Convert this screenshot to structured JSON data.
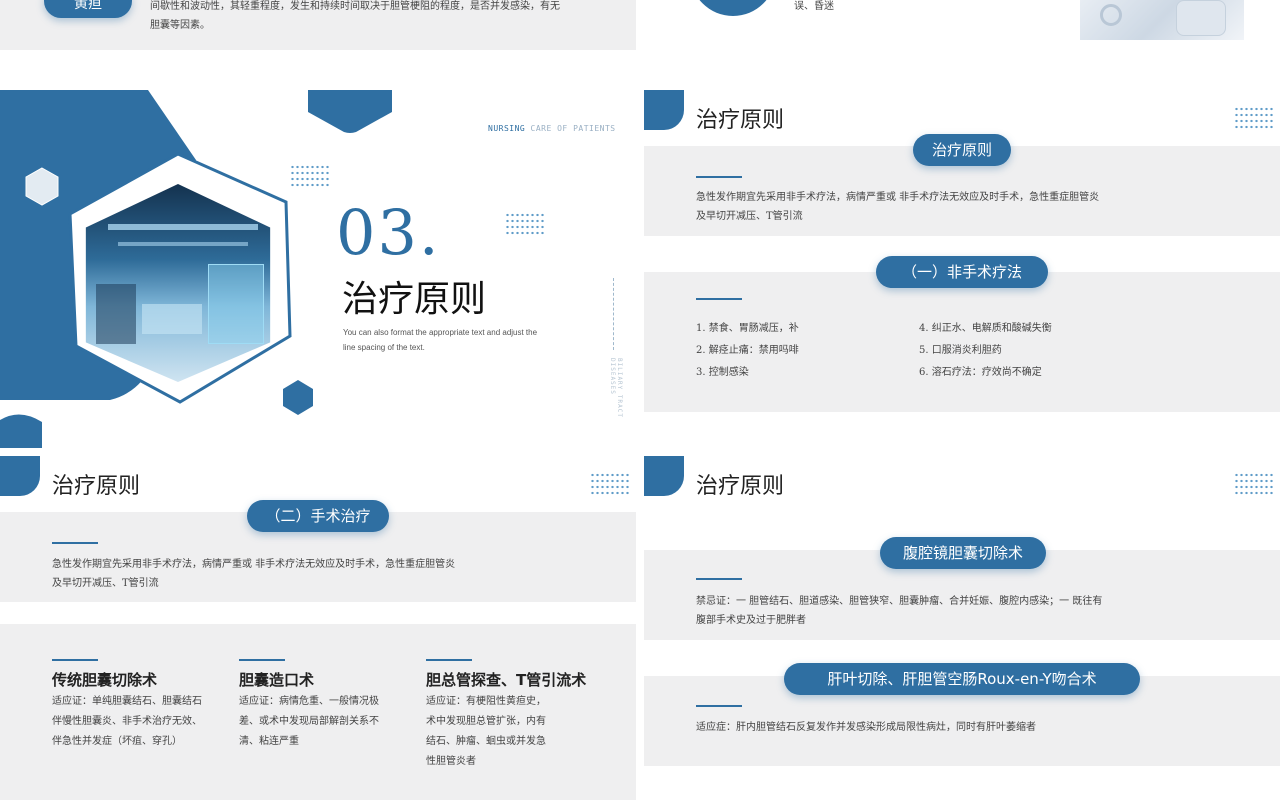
{
  "top_left": {
    "badge": "黄疸",
    "line1": "间歇性和波动性，其轻重程度，发生和持续时间取决于胆管梗阻的程度，是否并发感染，有无",
    "line2": "胆囊等因素。"
  },
  "top_right": {
    "text": "误、昏迷"
  },
  "cover": {
    "tag_highlight": "NURSING",
    "tag_rest": " CARE OF PATIENTS",
    "number": "03.",
    "title": "治疗原则",
    "subtitle_line1": "You can also format the appropriate text and adjust the",
    "subtitle_line2": "line spacing of the text.",
    "vertical_text": "BILIARY TRACT DISEASES"
  },
  "slide_right1": {
    "title": "治疗原则",
    "pill1": "治疗原则",
    "text1_line1": "急性发作期宜先采用非手术疗法，病情严重或  非手术疗法无效应及时手术，急性重症胆管炎",
    "text1_line2": "及早切开减压、T管引流",
    "pill2": "（一）非手术疗法",
    "list": [
      "1. 禁食、胃肠减压，补",
      "2. 解痉止痛：禁用吗啡",
      "3. 控制感染",
      "4. 纠正水、电解质和酸碱失衡",
      "5. 口服消炎利胆药",
      "6. 溶石疗法：疗效尚不确定"
    ]
  },
  "slide_left2": {
    "title": "治疗原则",
    "pill": "（二）手术治疗",
    "text_line1": "急性发作期宜先采用非手术疗法，病情严重或  非手术疗法无效应及时手术，急性重症胆管炎",
    "text_line2": "及早切开减压、T管引流",
    "columns": [
      {
        "title": "传统胆囊切除术",
        "lines": [
          "适应证：单纯胆囊结石、胆囊结石",
          "伴慢性胆囊炎、非手术治疗无效、",
          "伴急性并发症（坏疽、穿孔）"
        ]
      },
      {
        "title": "胆囊造口术",
        "lines": [
          "适应证：病情危重、一般情况极",
          "差、或术中发现局部解剖关系不",
          "清、粘连严重"
        ]
      },
      {
        "title": "胆总管探查、T管引流术",
        "lines": [
          "适应证：有梗阻性黄疸史，",
          "术中发现胆总管扩张，内有",
          "结石、肿瘤、蛔虫或并发急",
          "性胆管炎者"
        ]
      }
    ]
  },
  "slide_right2": {
    "title": "治疗原则",
    "pill1": "腹腔镜胆囊切除术",
    "text1_line1": "禁忌证：一  胆管结石、胆道感染、胆管狭窄、胆囊肿瘤、合并妊娠、腹腔内感染；一  既往有",
    "text1_line2": "腹部手术史及过于肥胖者",
    "pill2": "肝叶切除、肝胆管空肠Roux-en-Y吻合术",
    "text2": "适应症：肝内胆管结石反复发作并发感染形成局限性病灶，同时有肝叶萎缩者"
  },
  "colors": {
    "accent": "#2f6fa2",
    "band": "#efeff0"
  }
}
